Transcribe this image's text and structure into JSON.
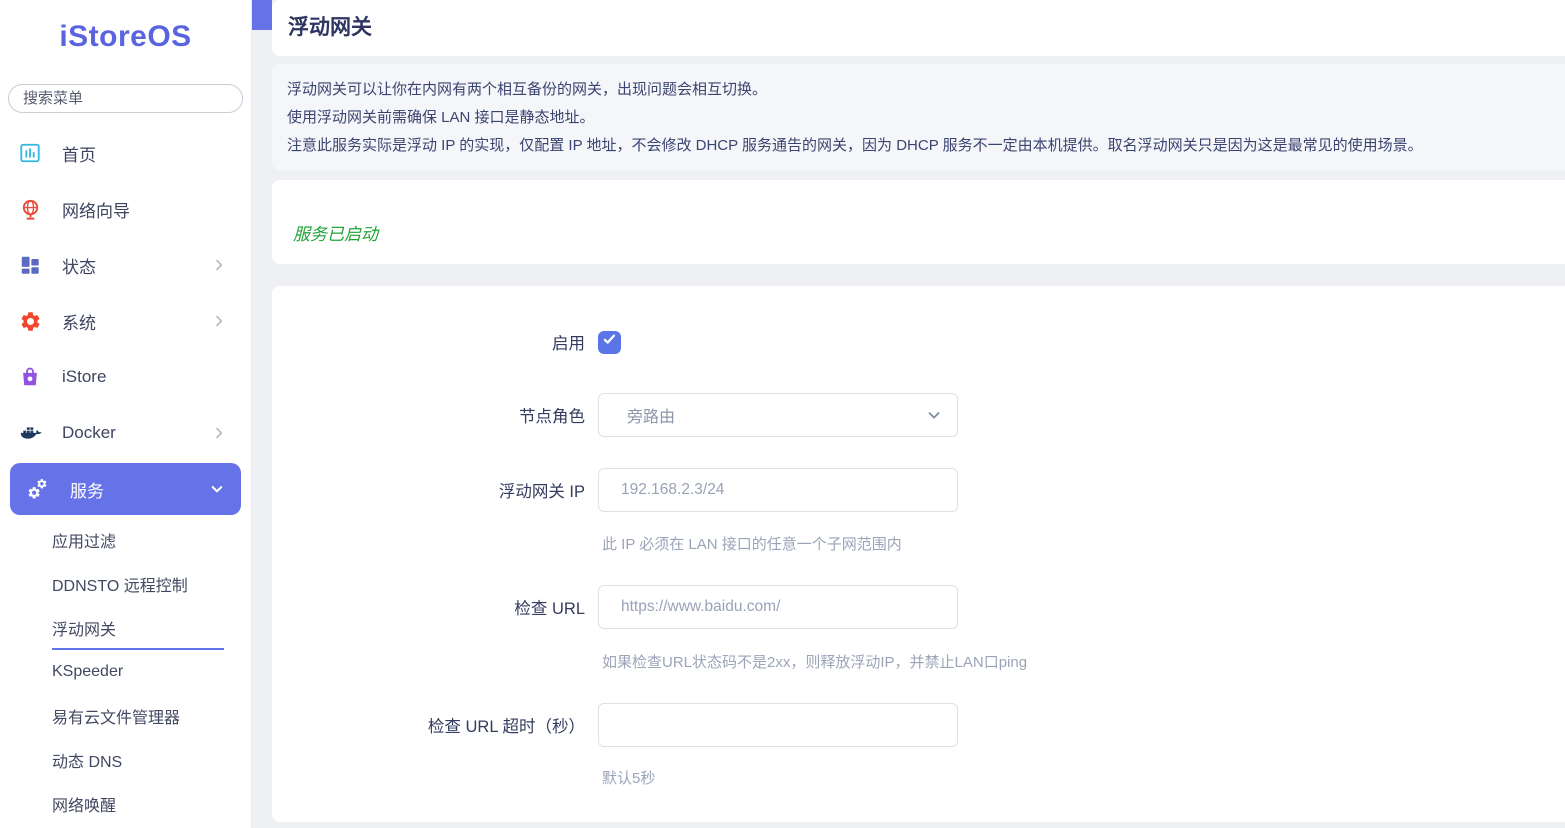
{
  "app": {
    "logo": "iStoreOS"
  },
  "sidebar": {
    "search_placeholder": "搜索菜单",
    "items": [
      {
        "label": "首页"
      },
      {
        "label": "网络向导"
      },
      {
        "label": "状态"
      },
      {
        "label": "系统"
      },
      {
        "label": "iStore"
      },
      {
        "label": "Docker"
      },
      {
        "label": "服务"
      }
    ],
    "submenu": [
      {
        "label": "应用过滤"
      },
      {
        "label": "DDNSTO 远程控制"
      },
      {
        "label": "浮动网关"
      },
      {
        "label": "KSpeeder"
      },
      {
        "label": "易有云文件管理器"
      },
      {
        "label": "动态 DNS"
      },
      {
        "label": "网络唤醒"
      }
    ]
  },
  "page": {
    "title": "浮动网关",
    "description_lines": [
      "浮动网关可以让你在内网有两个相互备份的网关，出现问题会相互切换。",
      "使用浮动网关前需确保 LAN 接口是静态地址。",
      "注意此服务实际是浮动 IP 的实现，仅配置 IP 地址，不会修改 DHCP 服务通告的网关，因为 DHCP 服务不一定由本机提供。取名浮动网关只是因为这是最常见的使用场景。"
    ],
    "status_text": "服务已启动"
  },
  "form": {
    "enable_label": "启用",
    "enable_checked": true,
    "role_label": "节点角色",
    "role_value": "旁路由",
    "ip_label": "浮动网关 IP",
    "ip_placeholder": "192.168.2.3/24",
    "ip_helper": "此 IP 必须在 LAN 接口的任意一个子网范围内",
    "url_label": "检查 URL",
    "url_placeholder": "https://www.baidu.com/",
    "url_helper": "如果检查URL状态码不是2xx，则释放浮动IP，并禁止LAN口ping",
    "timeout_label": "检查 URL 超时（秒）",
    "timeout_placeholder": "",
    "timeout_helper": "默认5秒"
  },
  "colors": {
    "accent": "#6673e8",
    "logo": "#5a64e0",
    "status_green": "#21a337",
    "active_underline": "#5d73e7",
    "page_background": "#eef0f4"
  }
}
